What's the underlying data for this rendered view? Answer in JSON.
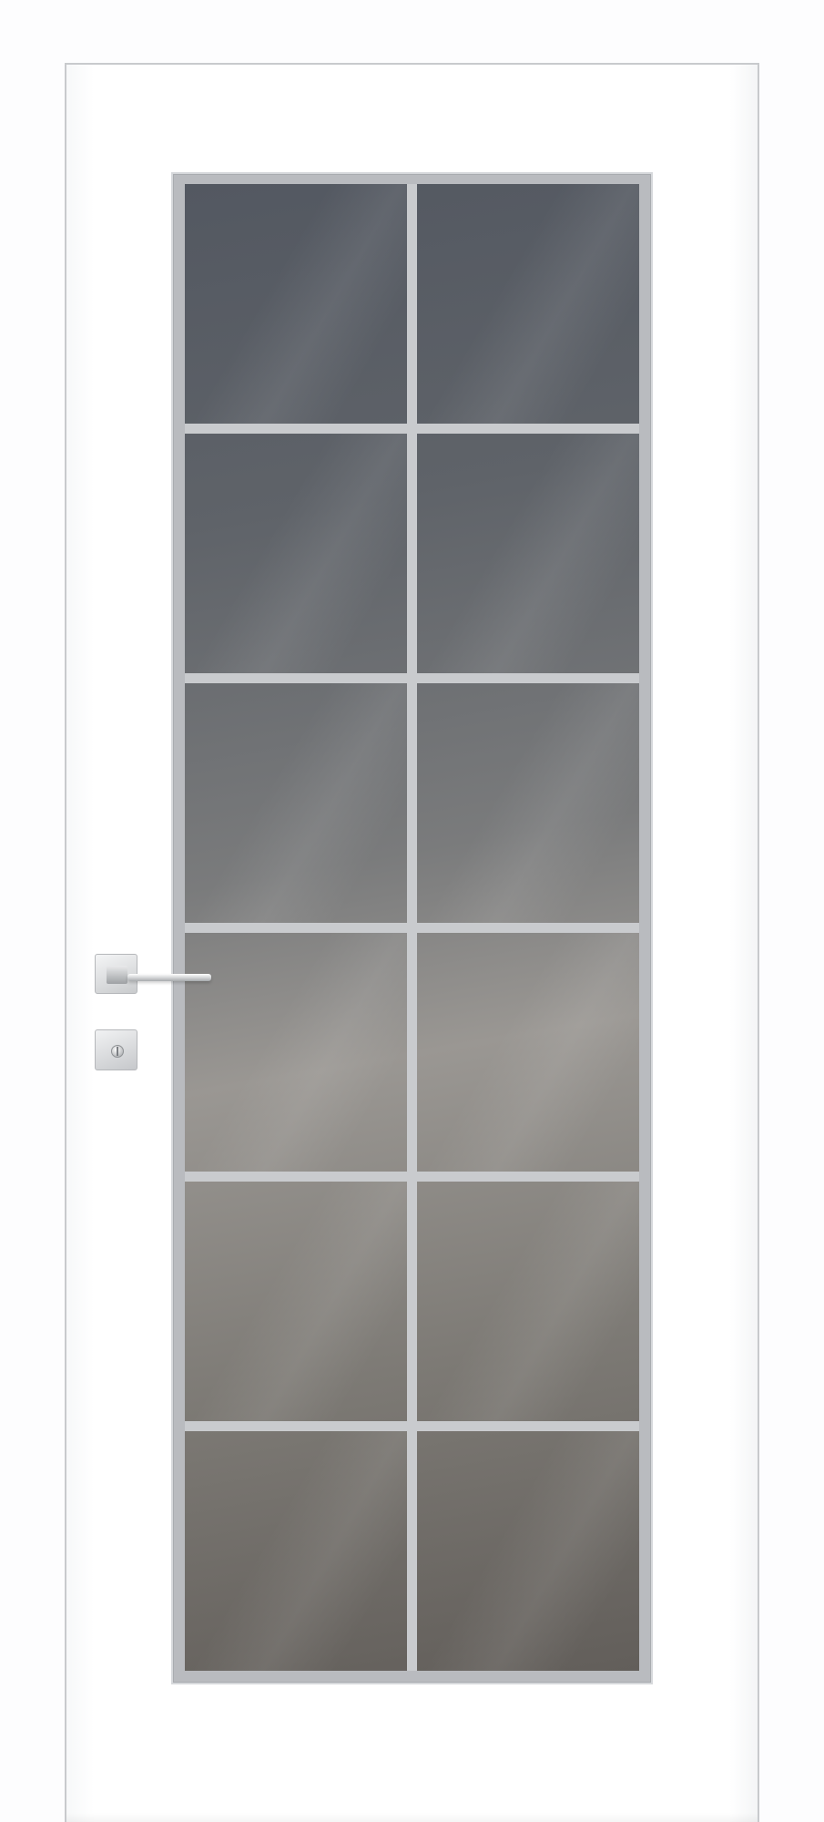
{
  "scene": {
    "subject": "door-with-glass-panel",
    "colors": {
      "door": "#ffffff",
      "frame_line": "#c8cacd",
      "muntin": "#c9cbce",
      "glass_dark": "#535861",
      "glass_light": "#9a9793",
      "hardware": "#c9cbcd"
    },
    "glass_grid": {
      "columns": 2,
      "rows": 6
    },
    "icons": {
      "handle": "lever-handle-icon",
      "lock": "thumb-turn-lock-icon"
    }
  }
}
